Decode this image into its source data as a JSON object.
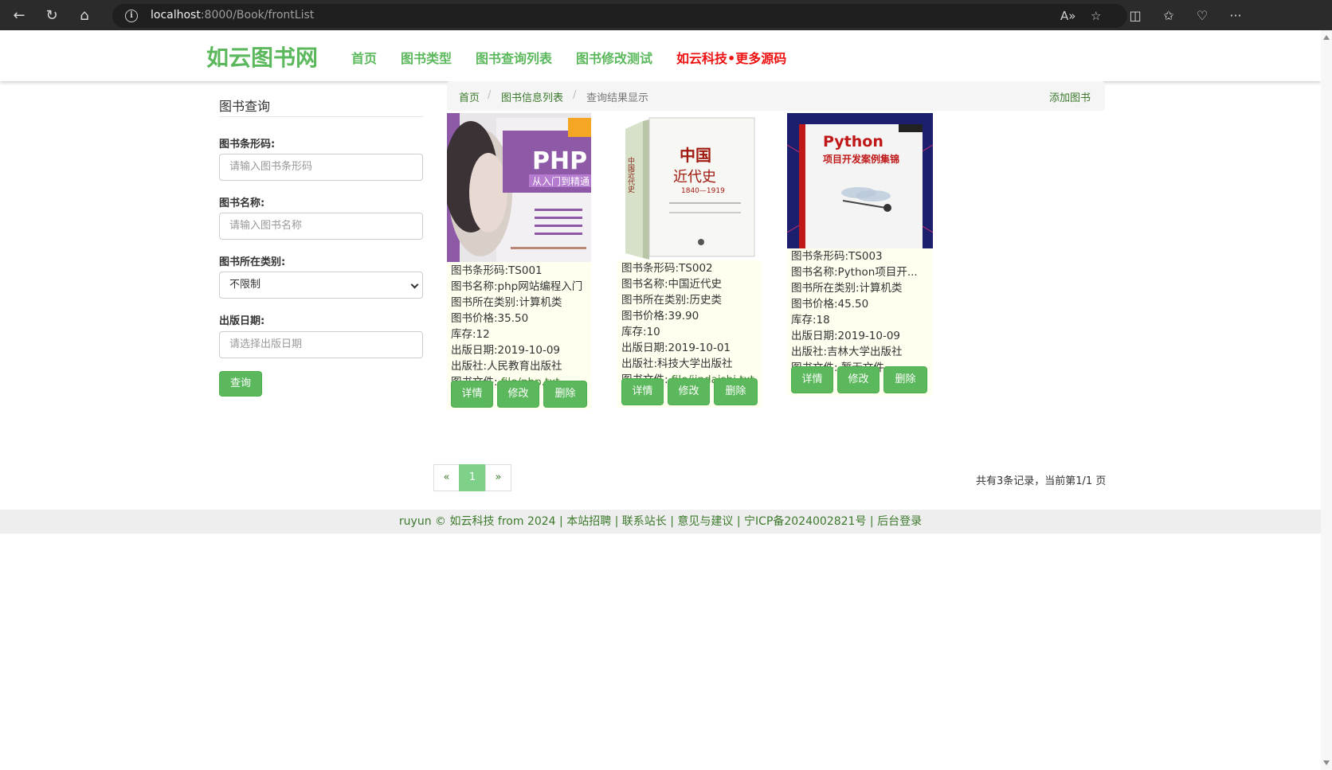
{
  "browser": {
    "url_host": "localhost",
    "url_rest": ":8000/Book/frontList"
  },
  "header": {
    "brand": "如云图书网",
    "nav": [
      "首页",
      "图书类型",
      "图书查询列表",
      "图书修改测试"
    ],
    "promo": "如云科技•更多源码"
  },
  "sidebar": {
    "title": "图书查询",
    "barcode_label": "图书条形码:",
    "barcode_placeholder": "请输入图书条形码",
    "name_label": "图书名称:",
    "name_placeholder": "请输入图书名称",
    "category_label": "图书所在类别:",
    "category_value": "不限制",
    "date_label": "出版日期:",
    "date_placeholder": "请选择出版日期",
    "query_button": "查询"
  },
  "breadcrumb": {
    "home": "首页",
    "list": "图书信息列表",
    "current": "查询结果显示",
    "add": "添加图书"
  },
  "books": [
    {
      "cover_title": "PHP",
      "cover_subtitle": "从入门到精通",
      "barcode": "图书条形码:TS001",
      "name": "图书名称:php网站编程入门",
      "category": "图书所在类别:计算机类",
      "price": "图书价格:35.50",
      "stock": "库存:12",
      "date": "出版日期:2019-10-09",
      "publisher": "出版社:人民教育出版社",
      "file_label": "图书文件: ",
      "file": "file/php.txt"
    },
    {
      "cover_title": "中国近代史",
      "cover_subtitle": "1840—1919",
      "barcode": "图书条形码:TS002",
      "name": "图书名称:中国近代史",
      "category": "图书所在类别:历史类",
      "price": "图书价格:39.90",
      "stock": "库存:10",
      "date": "出版日期:2019-10-01",
      "publisher": "出版社:科技大学出版社",
      "file_label": "图书文件: ",
      "file": "file/jindaishi.txt"
    },
    {
      "cover_title": "Python",
      "cover_subtitle": "项目开发案例集锦",
      "barcode": "图书条形码:TS003",
      "name": "图书名称:Python项目开...",
      "category": "图书所在类别:计算机类",
      "price": "图书价格:45.50",
      "stock": "库存:18",
      "date": "出版日期:2019-10-09",
      "publisher": "出版社:吉林大学出版社",
      "file_label": "图书文件: 暂无文件",
      "file": ""
    }
  ],
  "card_buttons": {
    "detail": "详情",
    "edit": "修改",
    "delete": "删除"
  },
  "pagination": {
    "prev": "«",
    "page": "1",
    "next": "»",
    "info": "共有3条记录，当前第1/1 页"
  },
  "footer": "ruyun © 如云科技 from 2024 | 本站招聘 | 联系站长 | 意见与建议 | 宁ICP备2024002821号 | 后台登录",
  "colors": {
    "accent": "#5cb85c",
    "promo": "#ee1111",
    "card_bg": "#fffff0"
  }
}
